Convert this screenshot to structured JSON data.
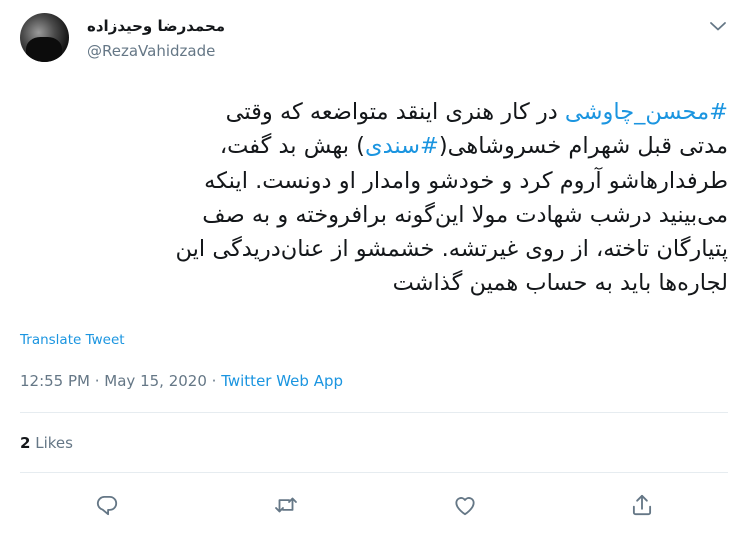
{
  "author": {
    "display_name": "محمدرضا وحیدزاده",
    "handle": "@RezaVahidzade"
  },
  "tweet": {
    "lines": [
      [
        {
          "text": "#محسن_چاوشی",
          "hashtag": true
        },
        {
          "text": " در کار هنری اینقد متواضعه که وقتی",
          "hashtag": false
        }
      ],
      [
        {
          "text": "مدتی قبل شهرام خسروشاهی(",
          "hashtag": false
        },
        {
          "text": "#سندی",
          "hashtag": true
        },
        {
          "text": ") بهش بد گفت،",
          "hashtag": false
        }
      ],
      [
        {
          "text": "طرفدارهاشو آروم کرد و خودشو وامدار او دونست. اینکه",
          "hashtag": false
        }
      ],
      [
        {
          "text": "می‌بینید درشب شهادت مولا این‌گونه برافروخته و به صف",
          "hashtag": false
        }
      ],
      [
        {
          "text": "پتیارگان تاخته، از روی غیرتشه. خشمشو از عنان‌دریدگی این",
          "hashtag": false
        }
      ],
      [
        {
          "text": "لجاره‌ها باید به حساب همین گذاشت",
          "hashtag": false
        }
      ]
    ],
    "translate_label": "Translate Tweet",
    "time": "12:55 PM",
    "date": "May 15, 2020",
    "separator": " · ",
    "app": "Twitter Web App",
    "likes_count": "2",
    "likes_label": "Likes"
  },
  "icons": {
    "caret": "chevron-down-icon",
    "reply": "reply-icon",
    "retweet": "retweet-icon",
    "like": "heart-icon",
    "share": "share-icon"
  },
  "colors": {
    "accent": "#1b95e0",
    "secondary_text": "#657786",
    "primary_text": "#14171a",
    "divider": "#e6ecf0"
  }
}
